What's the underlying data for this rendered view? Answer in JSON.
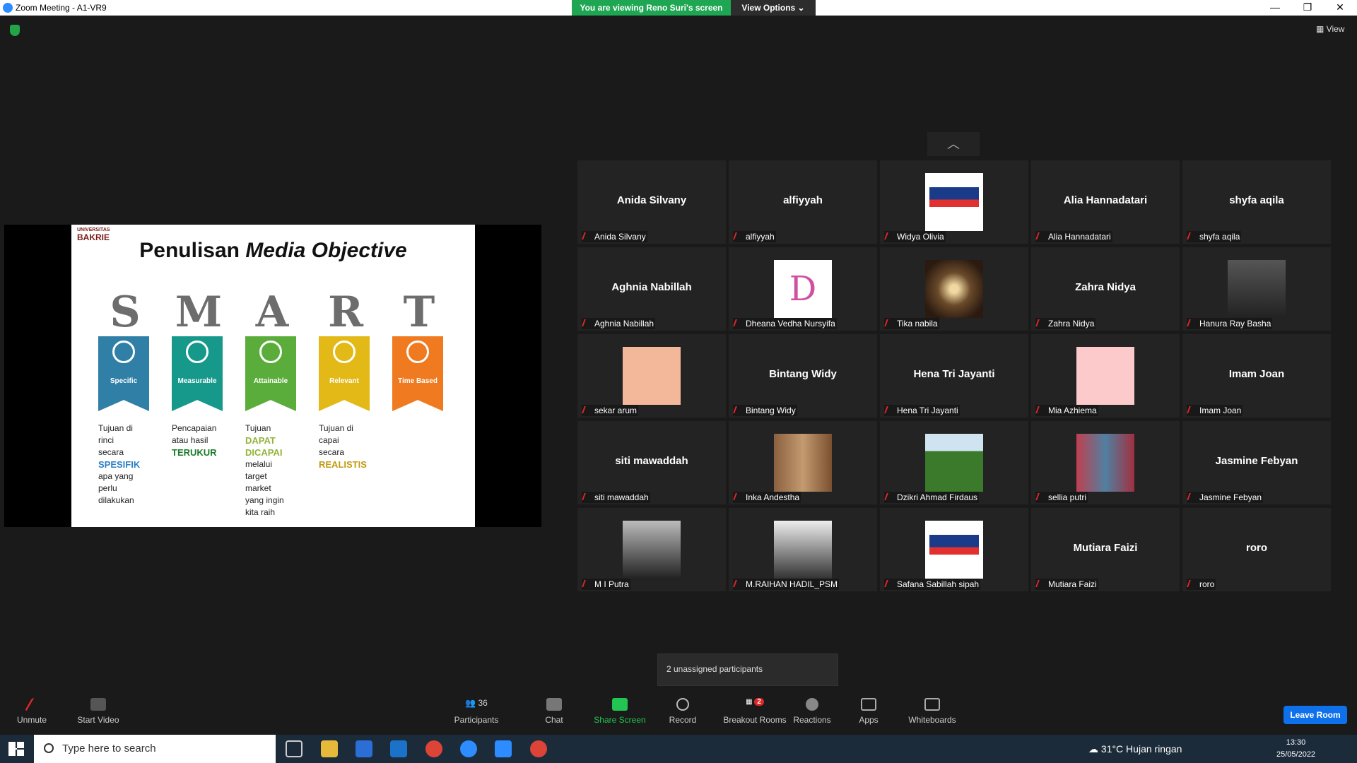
{
  "window": {
    "title": "Zoom Meeting - A1-VR9",
    "banner": "You are viewing Reno Suri's screen",
    "view_options": "View Options ⌄",
    "min": "—",
    "max": "❐",
    "close": "✕"
  },
  "view_button": "View",
  "slide": {
    "logo_small": "UNIVERSITAS",
    "logo": "BAKRIE",
    "title_plain": "Penulisan ",
    "title_italic": "Media Objective",
    "columns": [
      {
        "letter": "S",
        "label": "Specific",
        "color": "#2f7fa6",
        "lines": [
          "Tujuan di",
          "rinci",
          "secara"
        ],
        "key": "SPESIFIK",
        "key_color": "#2a7fc4",
        "after": [
          "apa yang",
          "perlu",
          "dilakukan"
        ]
      },
      {
        "letter": "M",
        "label": "Measurable",
        "color": "#16998a",
        "lines": [
          "Pencapaian",
          "atau hasil"
        ],
        "key": "TERUKUR",
        "key_color": "#1a7a2a",
        "after": []
      },
      {
        "letter": "A",
        "label": "Attainable",
        "color": "#5aad3b",
        "lines": [
          "Tujuan"
        ],
        "key": "DAPAT DICAPAI",
        "key_color": "#93b43a",
        "after": [
          "melalui",
          "target",
          "market",
          "yang ingin",
          "kita raih"
        ]
      },
      {
        "letter": "R",
        "label": "Relevant",
        "color": "#e3b917",
        "lines": [
          "Tujuan di",
          "capai",
          "secara"
        ],
        "key": "REALISTIS",
        "key_color": "#c29a12",
        "after": []
      },
      {
        "letter": "T",
        "label": "Time Based",
        "color": "#ef7a1f",
        "lines": [],
        "key": "",
        "key_color": "#ef7a1f",
        "after": []
      }
    ]
  },
  "tiles": [
    {
      "name": "Anida Silvany",
      "label": "Anida Silvany",
      "pic": ""
    },
    {
      "name": "alfiyyah",
      "label": "alfiyyah",
      "pic": ""
    },
    {
      "name": "",
      "label": "Widya Olivia",
      "pic": "logo"
    },
    {
      "name": "Alia Hannadatari",
      "label": "Alia Hannadatari",
      "pic": ""
    },
    {
      "name": "shyfa aqila",
      "label": "shyfa aqila",
      "pic": ""
    },
    {
      "name": "Aghnia Nabillah",
      "label": "Aghnia Nabillah",
      "pic": ""
    },
    {
      "name": "",
      "label": "Dheana Vedha Nursyifa",
      "pic": "d"
    },
    {
      "name": "",
      "label": "Tika nabila",
      "pic": "lamp"
    },
    {
      "name": "Zahra Nidya",
      "label": "Zahra Nidya",
      "pic": ""
    },
    {
      "name": "",
      "label": "Hanura Ray Basha",
      "pic": "dark"
    },
    {
      "name": "",
      "label": "sekar arum",
      "pic": "peach"
    },
    {
      "name": "Bintang Widy",
      "label": "Bintang Widy",
      "pic": ""
    },
    {
      "name": "Hena Tri Jayanti",
      "label": "Hena Tri Jayanti",
      "pic": ""
    },
    {
      "name": "",
      "label": "Mia Azhiema",
      "pic": "pink"
    },
    {
      "name": "Imam Joan",
      "label": "Imam Joan",
      "pic": ""
    },
    {
      "name": "siti mawaddah",
      "label": "siti mawaddah",
      "pic": ""
    },
    {
      "name": "",
      "label": "Inka Andestha",
      "pic": "forest"
    },
    {
      "name": "",
      "label": "Dzikri Ahmad Firdaus",
      "pic": "green"
    },
    {
      "name": "",
      "label": "sellia putri",
      "pic": "shop"
    },
    {
      "name": "Jasmine Febyan",
      "label": "Jasmine Febyan",
      "pic": ""
    },
    {
      "name": "",
      "label": "M I Putra",
      "pic": "mirror"
    },
    {
      "name": "",
      "label": "M.RAIHAN HADIL_PSM",
      "pic": "group"
    },
    {
      "name": "",
      "label": "Safana Sabillah sipah",
      "pic": "logo"
    },
    {
      "name": "Mutiara Faizi",
      "label": "Mutiara Faizi",
      "pic": ""
    },
    {
      "name": "roro",
      "label": "roro",
      "pic": ""
    }
  ],
  "unassigned": "2 unassigned participants",
  "controls": {
    "unmute": "Unmute",
    "start_video": "Start Video",
    "participants": "Participants",
    "participants_count": "36",
    "chat": "Chat",
    "share": "Share Screen",
    "record": "Record",
    "breakout": "Breakout Rooms",
    "breakout_badge": "2",
    "reactions": "Reactions",
    "apps": "Apps",
    "whiteboards": "Whiteboards",
    "leave": "Leave Room"
  },
  "taskbar": {
    "search": "Type here to search",
    "weather": "31°C  Hujan ringan",
    "time": "13:30",
    "date": "25/05/2022"
  },
  "colors": {
    "green": "#1fa653",
    "blue": "#0e71eb"
  }
}
